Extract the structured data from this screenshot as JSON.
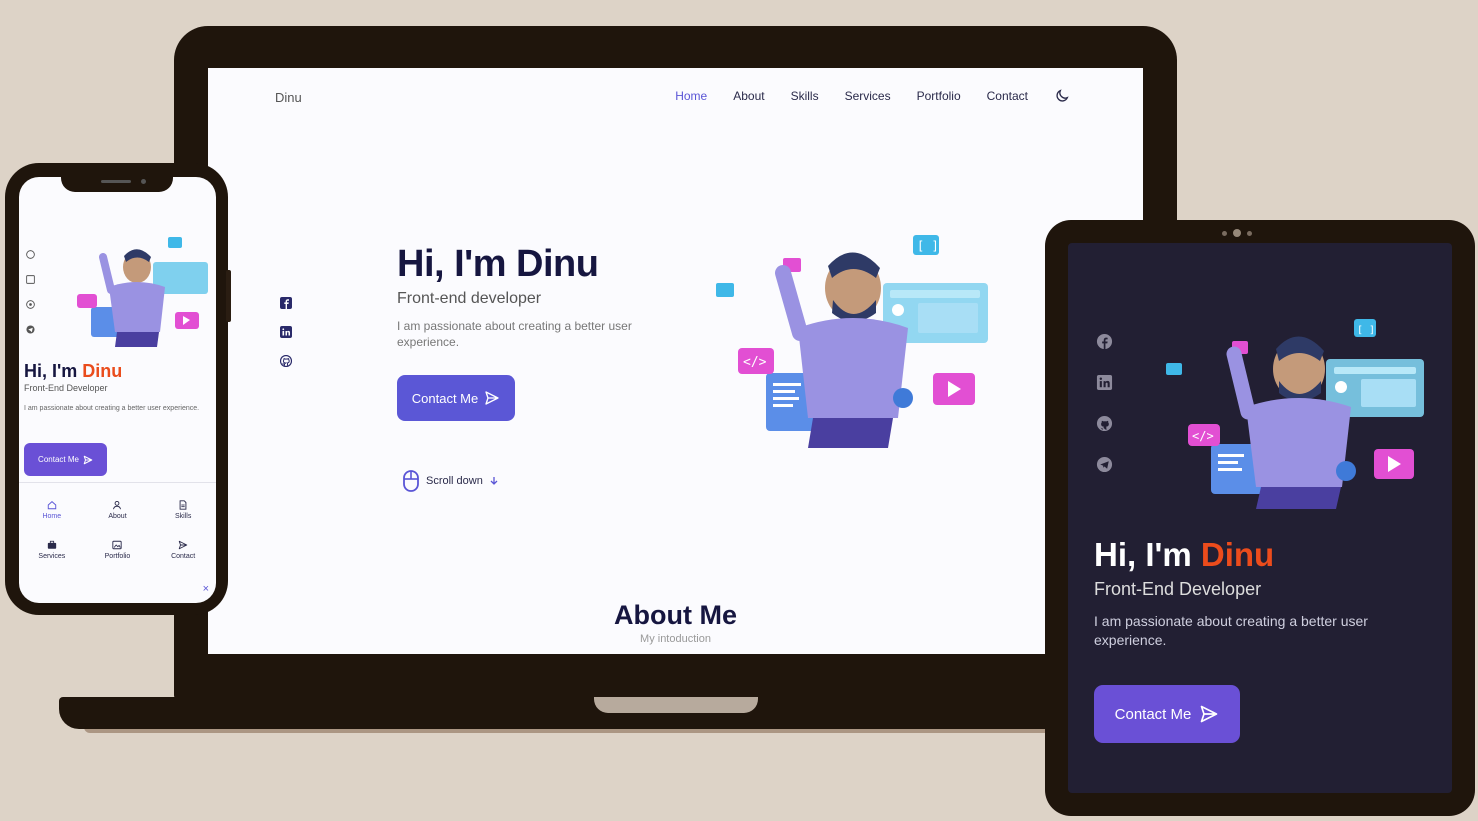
{
  "laptop": {
    "logo": "Dinu",
    "nav": [
      "Home",
      "About",
      "Skills",
      "Services",
      "Portfolio",
      "Contact"
    ],
    "hero": {
      "title": "Hi, I'm Dinu",
      "subtitle": "Front-end developer",
      "description": "I am passionate about creating a better user experience.",
      "button": "Contact Me",
      "scroll": "Scroll down"
    },
    "about": {
      "title": "About Me",
      "subtitle": "My intoduction"
    }
  },
  "phone": {
    "hero": {
      "title_prefix": "Hi, I'm ",
      "title_name": "Dinu",
      "subtitle": "Front-End Developer",
      "description": "I am passionate about creating a better user experience.",
      "button": "Contact Me"
    },
    "menu": [
      "Home",
      "About",
      "Skills",
      "Services",
      "Portfolio",
      "Contact"
    ],
    "close": "×"
  },
  "tablet": {
    "hero": {
      "title_prefix": "Hi, I'm ",
      "title_name": "Dinu",
      "subtitle": "Front-End Developer",
      "description": "I am passionate about creating a better user experience.",
      "button": "Contact Me"
    }
  },
  "colors": {
    "background": "#ddd3c7",
    "device_frame": "#1f150c",
    "accent": "#5b57d6",
    "accent_button": "#6a50d6",
    "name_highlight": "#ea4c1c",
    "dark_screen": "#221f33"
  },
  "icons": [
    "facebook-icon",
    "linkedin-icon",
    "github-icon",
    "telegram-icon",
    "moon-icon",
    "send-icon",
    "mouse-icon",
    "arrow-down-icon",
    "home-icon",
    "user-icon",
    "file-icon",
    "briefcase-icon",
    "image-icon",
    "close-icon"
  ]
}
